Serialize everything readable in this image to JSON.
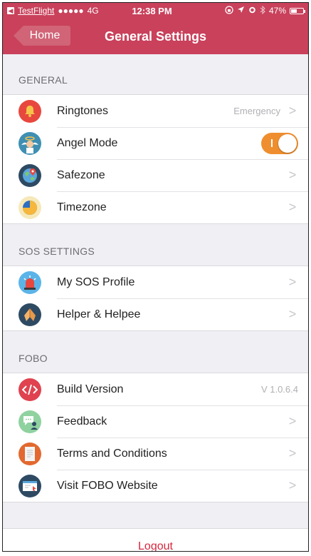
{
  "status_bar": {
    "carrier": "TestFlight",
    "signal": "●●●●●",
    "network": "4G",
    "time": "12:38 PM",
    "battery_percent": "47%",
    "battery_level": 0.47
  },
  "nav": {
    "back_label": "Home",
    "title": "General Settings"
  },
  "sections": {
    "general": {
      "header": "GENERAL",
      "ringtones": {
        "label": "Ringtones",
        "value": "Emergency"
      },
      "angel_mode": {
        "label": "Angel Mode",
        "on": true
      },
      "safezone": {
        "label": "Safezone"
      },
      "timezone": {
        "label": "Timezone"
      }
    },
    "sos": {
      "header": "SOS SETTINGS",
      "profile": {
        "label": "My SOS Profile"
      },
      "helper": {
        "label": "Helper & Helpee"
      }
    },
    "fobo": {
      "header": "FOBO",
      "build": {
        "label": "Build Version",
        "value": "V 1.0.6.4"
      },
      "feedback": {
        "label": "Feedback"
      },
      "terms": {
        "label": "Terms and Conditions"
      },
      "website": {
        "label": "Visit FOBO Website"
      }
    }
  },
  "logout_label": "Logout",
  "chevron": ">",
  "colors": {
    "brand": "#c9415b",
    "toggle_on": "#ef8e2e",
    "logout": "#d7263d"
  }
}
